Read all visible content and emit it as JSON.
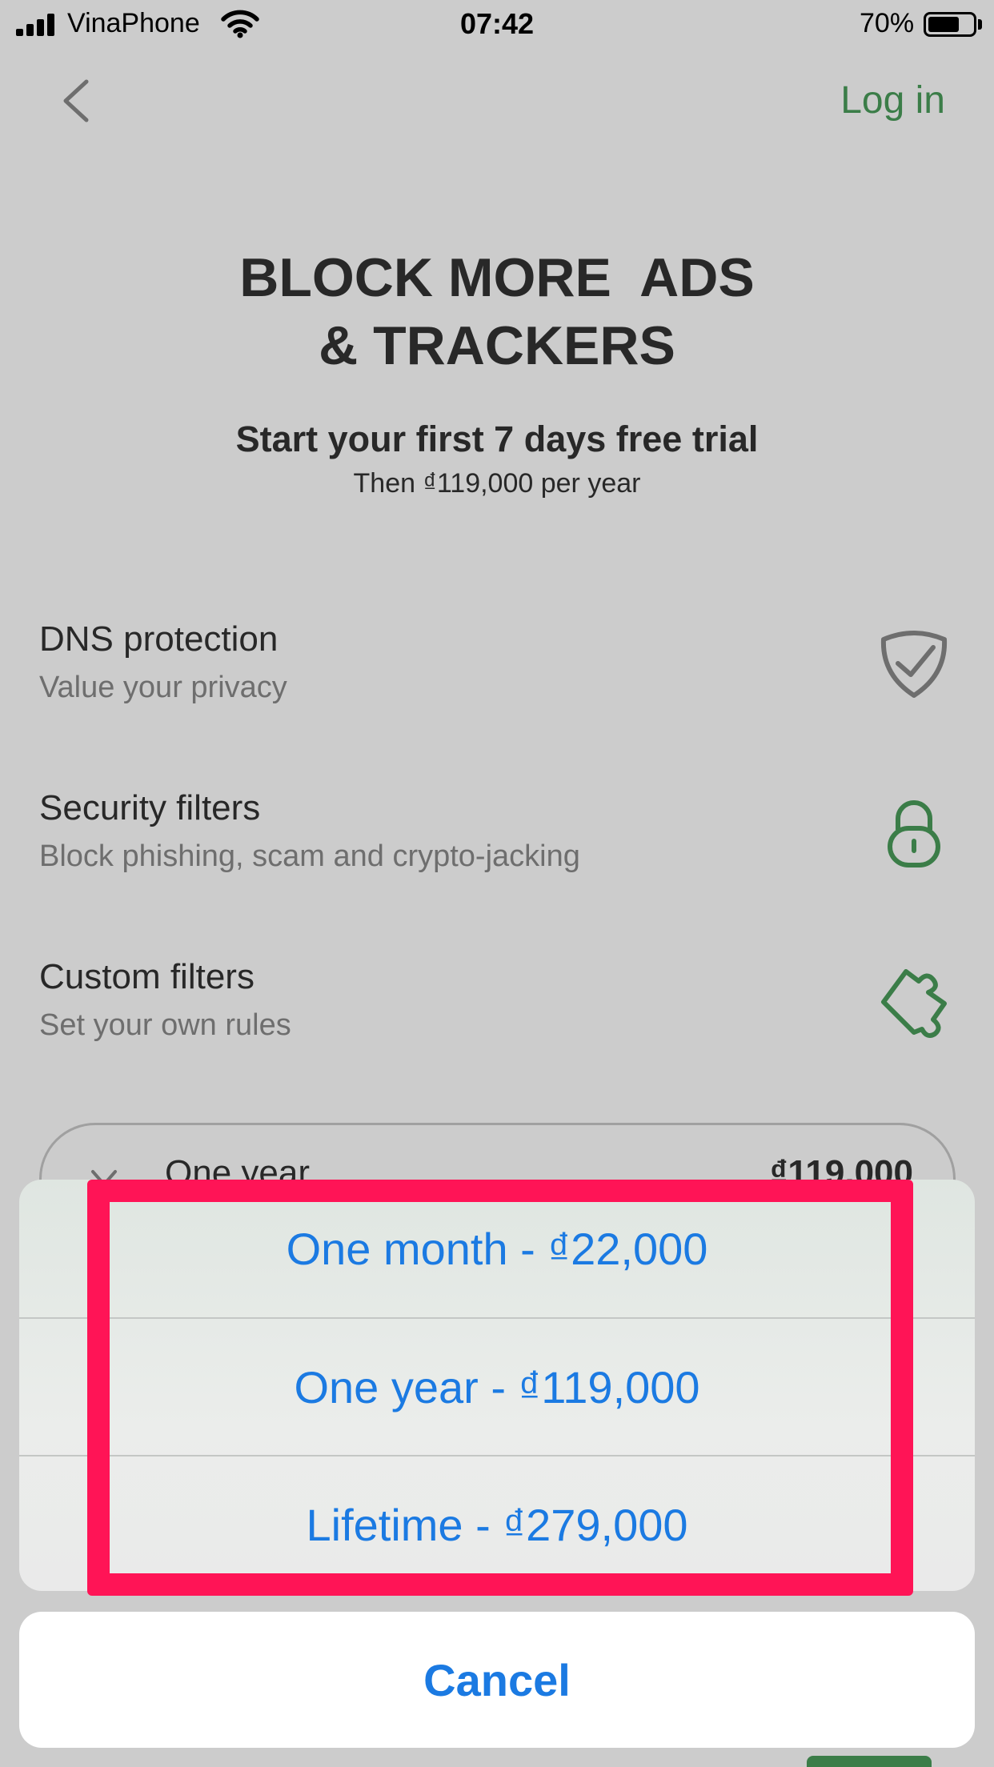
{
  "status_bar": {
    "carrier": "VinaPhone",
    "time": "07:42",
    "battery_percent": "70%",
    "battery_level": 0.7,
    "signal_bars": 4
  },
  "nav": {
    "back_icon": "chevron-left-icon",
    "login_label": "Log in"
  },
  "hero": {
    "title_line1": "BLOCK MORE  ADS",
    "title_line2": "& TRACKERS",
    "trial_text": "Start your first 7 days free trial",
    "price_note": "Then ₫119,000 per year"
  },
  "features": [
    {
      "title": "DNS protection",
      "subtitle": "Value your privacy",
      "icon": "shield-check-icon"
    },
    {
      "title": "Security filters",
      "subtitle": "Block phishing, scam and crypto-jacking",
      "icon": "lock-icon"
    },
    {
      "title": "Custom filters",
      "subtitle": "Set your own rules",
      "icon": "puzzle-icon"
    }
  ],
  "plan_selector": {
    "name": "One year",
    "price": "₫119,000"
  },
  "action_sheet": {
    "options": [
      "One month - ₫22,000",
      "One year - ₫119,000",
      "Lifetime - ₫279,000"
    ],
    "cancel_label": "Cancel"
  },
  "colors": {
    "accent_green": "#4a9d5b",
    "ios_blue": "#1b7ae2",
    "highlight_pink": "#ff1456"
  }
}
